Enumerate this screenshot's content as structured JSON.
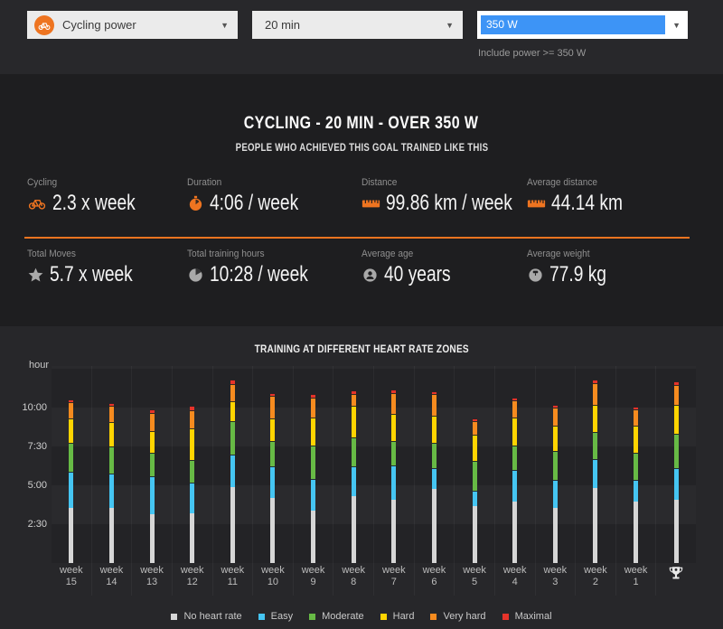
{
  "filters": {
    "sport": {
      "value": "Cycling power",
      "icon": "cycling-icon"
    },
    "duration": {
      "value": "20 min"
    },
    "power": {
      "value": "350 W"
    },
    "power_note": "Include power >= 350 W"
  },
  "summary": {
    "title": "CYCLING - 20 MIN - OVER 350 W",
    "subtitle": "PEOPLE WHO ACHIEVED THIS GOAL TRAINED LIKE THIS",
    "stats": [
      {
        "label": "Cycling",
        "value": "2.3 x week",
        "icon": "bicycle-icon"
      },
      {
        "label": "Duration",
        "value": "4:06 / week",
        "icon": "stopwatch-icon"
      },
      {
        "label": "Distance",
        "value": "99.86 km / week",
        "icon": "ruler-icon"
      },
      {
        "label": "Average distance",
        "value": "44.14 km",
        "icon": "ruler-icon"
      },
      {
        "label": "Total Moves",
        "value": "5.7 x week",
        "icon": "star-icon"
      },
      {
        "label": "Total training hours",
        "value": "10:28 / week",
        "icon": "clock-icon"
      },
      {
        "label": "Average age",
        "value": "40 years",
        "icon": "person-icon"
      },
      {
        "label": "Average weight",
        "value": "77.9 kg",
        "icon": "scale-icon"
      }
    ]
  },
  "chart_data": {
    "type": "bar",
    "stacked": true,
    "title": "TRAINING AT DIFFERENT HEART RATE ZONES",
    "ylabel": "hour",
    "ytick_labels": [
      "2:30",
      "5:00",
      "7:30",
      "10:00"
    ],
    "ytick_hours": [
      2.5,
      5,
      7.5,
      10
    ],
    "ylim_hours": [
      0,
      12.7
    ],
    "grid": "subtle-bands-and-column-lines",
    "categories": [
      "week 15",
      "week 14",
      "week 13",
      "week 12",
      "week 11",
      "week 10",
      "week 9",
      "week 8",
      "week 7",
      "week 6",
      "week 5",
      "week 4",
      "week 3",
      "week 2",
      "week 1",
      "trophy"
    ],
    "last_category_icon": "trophy-icon",
    "zone_colors": [
      "#d6d6d6",
      "#45c5f2",
      "#67ba45",
      "#ffd400",
      "#f68b1f",
      "#e6332a"
    ],
    "series": [
      {
        "name": "No heart rate",
        "values": [
          3.53,
          3.55,
          3.14,
          3.2,
          4.88,
          4.16,
          3.39,
          4.3,
          4.07,
          4.74,
          3.68,
          3.97,
          3.53,
          4.84,
          3.97,
          4.07
        ]
      },
      {
        "name": "Easy",
        "values": [
          2.35,
          2.21,
          2.44,
          1.98,
          2.09,
          2.08,
          2.03,
          1.94,
          2.23,
          1.36,
          0.97,
          2.03,
          1.84,
          1.84,
          1.36,
          2.03
        ]
      },
      {
        "name": "Moderate",
        "values": [
          1.85,
          1.74,
          1.51,
          1.45,
          2.15,
          1.61,
          2.13,
          1.84,
          1.55,
          1.65,
          1.94,
          1.55,
          1.84,
          1.74,
          1.74,
          2.23
        ]
      },
      {
        "name": "Hard",
        "values": [
          1.58,
          1.57,
          1.4,
          2.03,
          1.28,
          1.45,
          1.84,
          2.03,
          1.74,
          1.74,
          1.65,
          1.84,
          1.65,
          1.74,
          1.74,
          1.84
        ]
      },
      {
        "name": "Very hard",
        "values": [
          1.07,
          1.05,
          1.16,
          1.16,
          1.1,
          1.45,
          1.26,
          0.74,
          1.36,
          1.4,
          0.87,
          1.1,
          1.13,
          1.4,
          1.07,
          1.3
        ]
      },
      {
        "name": "Maximal",
        "values": [
          0.16,
          0.17,
          0.23,
          0.29,
          0.29,
          0.17,
          0.23,
          0.23,
          0.2,
          0.17,
          0.17,
          0.17,
          0.17,
          0.23,
          0.17,
          0.23
        ]
      }
    ],
    "legend": [
      {
        "label": "No heart rate",
        "color": "#d6d6d6"
      },
      {
        "label": "Easy",
        "color": "#45c5f2"
      },
      {
        "label": "Moderate",
        "color": "#67ba45"
      },
      {
        "label": "Hard",
        "color": "#ffd400"
      },
      {
        "label": "Very hard",
        "color": "#f68b1f"
      },
      {
        "label": "Maximal",
        "color": "#e6332a"
      }
    ],
    "legend_position": "bottom-center"
  },
  "colors": {
    "accent_orange": "#ee7420",
    "selection_blue": "#3d94f6",
    "panel_dark": "#1e1e20",
    "panel_light": "#28282b"
  }
}
